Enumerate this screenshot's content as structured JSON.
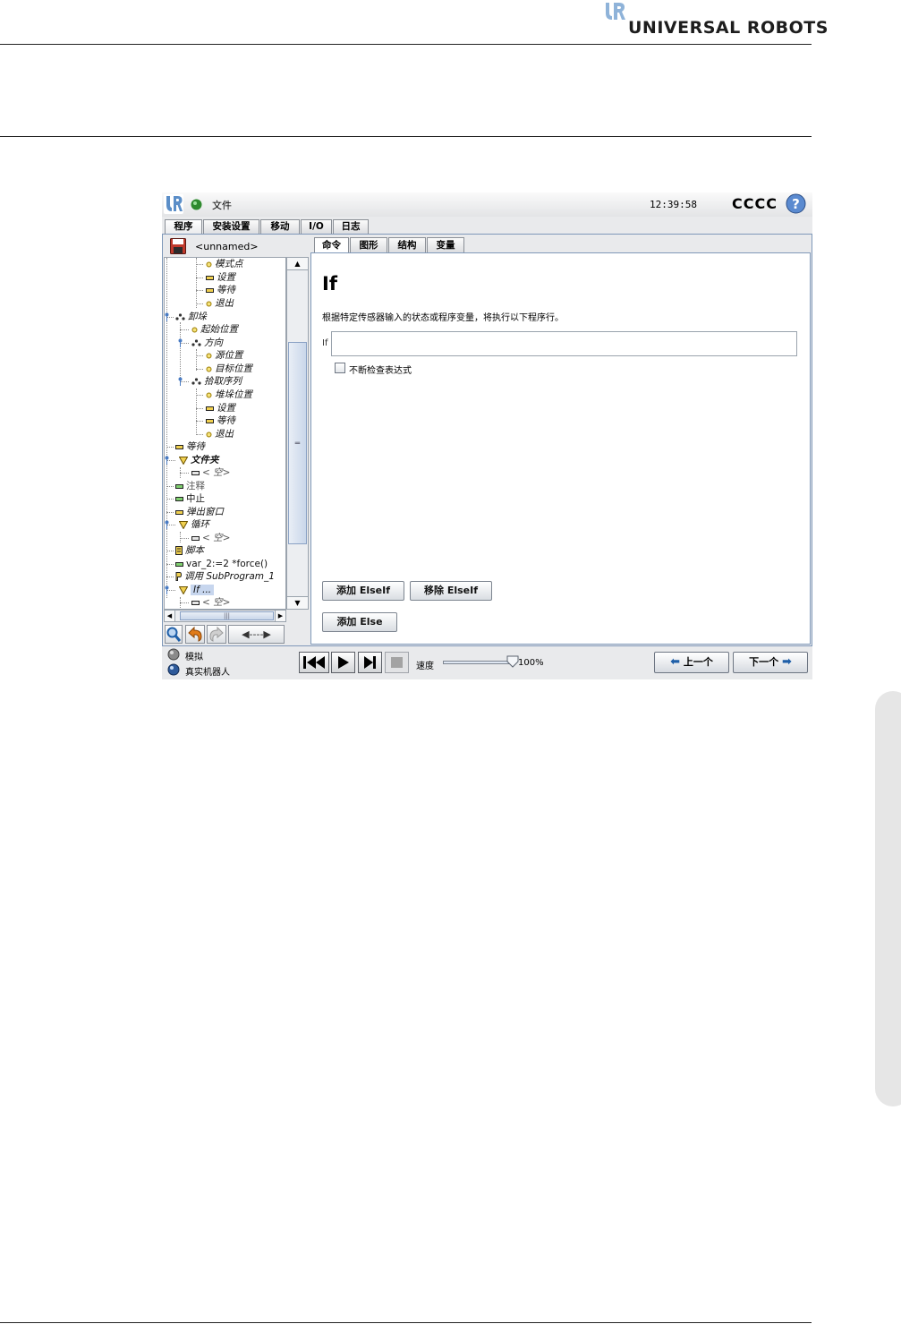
{
  "brand": {
    "name": "UNIVERSAL ROBOTS"
  },
  "app": {
    "menu_file": "文件",
    "time": "12:39:58",
    "robot_name": "CCCC",
    "main_tabs": [
      "程序",
      "安装设置",
      "移动",
      "I/O",
      "日志"
    ],
    "active_main_tab": "程序"
  },
  "program": {
    "file_name": "<unnamed>"
  },
  "tree": {
    "items": [
      {
        "label": "模式点",
        "icon": "waypoint-icon"
      },
      {
        "label": "设置",
        "icon": "set-icon"
      },
      {
        "label": "等待",
        "icon": "wait-icon"
      },
      {
        "label": "退出",
        "icon": "waypoint-icon"
      },
      {
        "label": "卸垛",
        "icon": "pattern-icon"
      },
      {
        "label": "起始位置",
        "icon": "waypoint-icon"
      },
      {
        "label": "方向",
        "icon": "pattern-icon"
      },
      {
        "label": "源位置",
        "icon": "waypoint-icon"
      },
      {
        "label": "目标位置",
        "icon": "waypoint-icon"
      },
      {
        "label": "拾取序列",
        "icon": "pattern-icon"
      },
      {
        "label": "堆垛位置",
        "icon": "waypoint-icon"
      },
      {
        "label": "设置",
        "icon": "set-icon"
      },
      {
        "label": "等待",
        "icon": "wait-icon"
      },
      {
        "label": "退出",
        "icon": "waypoint-icon"
      },
      {
        "label": "等待",
        "icon": "wait-icon"
      },
      {
        "label": "文件夹",
        "icon": "folder-icon"
      },
      {
        "label": "< 空>",
        "icon": "empty-icon"
      },
      {
        "label": "注释",
        "icon": "comment-icon"
      },
      {
        "label": "中止",
        "icon": "halt-icon"
      },
      {
        "label": "弹出窗口",
        "icon": "popup-icon"
      },
      {
        "label": "循环",
        "icon": "loop-icon"
      },
      {
        "label": "< 空>",
        "icon": "empty-icon"
      },
      {
        "label": "脚本",
        "icon": "script-icon"
      },
      {
        "label": "var_2:=2 *force()",
        "icon": "assignment-icon"
      },
      {
        "label": "调用 SubProgram_1",
        "icon": "call-icon"
      },
      {
        "label": "If ...",
        "icon": "if-icon"
      },
      {
        "label": "< 空>",
        "icon": "empty-icon"
      }
    ]
  },
  "sub_tabs": [
    "命令",
    "图形",
    "结构",
    "变量"
  ],
  "active_sub_tab": "命令",
  "command": {
    "heading": "If",
    "description": "根据特定传感器输入的状态或程序变量，将执行以下程序行。",
    "if_label": "If",
    "if_value": "",
    "checkbox_label": "不断检查表达式",
    "checkbox_checked": false,
    "add_elseif": "添加 ElseIf",
    "remove_elseif": "移除 ElseIf",
    "add_else": "添加 Else"
  },
  "toolbar": {
    "arrow_label": "◀----▶"
  },
  "mode": {
    "simulation": "模拟",
    "real_robot": "真实机器人"
  },
  "speed": {
    "label": "速度",
    "value": "100%",
    "fraction": 1.0
  },
  "nav": {
    "prev": "上一个",
    "next": "下一个"
  }
}
